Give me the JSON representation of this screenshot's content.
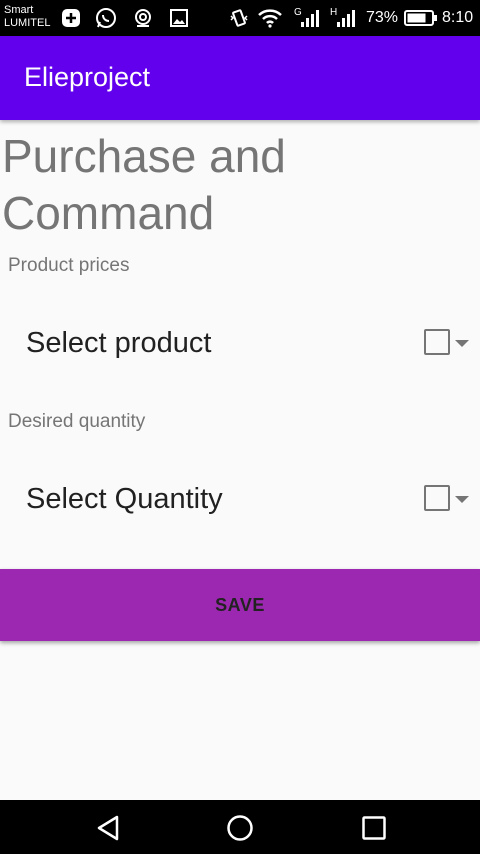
{
  "status_bar": {
    "carrier_line1": "Smart",
    "carrier_line2": "LUMITEL",
    "network_g": "G",
    "network_h": "H",
    "battery": "73%",
    "time": "8:10"
  },
  "app_bar": {
    "title": "Elieproject"
  },
  "main": {
    "heading": "Purchase and Command",
    "product_label": "Product prices",
    "product_spinner": "Select product",
    "quantity_label": "Desired quantity",
    "quantity_spinner": "Select Quantity",
    "save_label": "SAVE"
  },
  "icons": {
    "notifications": [
      "add-box-icon",
      "whatsapp-icon",
      "location-icon",
      "image-icon"
    ],
    "system": [
      "vibrate-icon",
      "wifi-icon",
      "signal-icon",
      "signal-icon",
      "battery-icon"
    ],
    "nav": [
      "back-icon",
      "home-icon",
      "recents-icon"
    ]
  },
  "colors": {
    "app_bar": "#6200ee",
    "save_button": "#9c27b0",
    "background": "#fafafa"
  }
}
